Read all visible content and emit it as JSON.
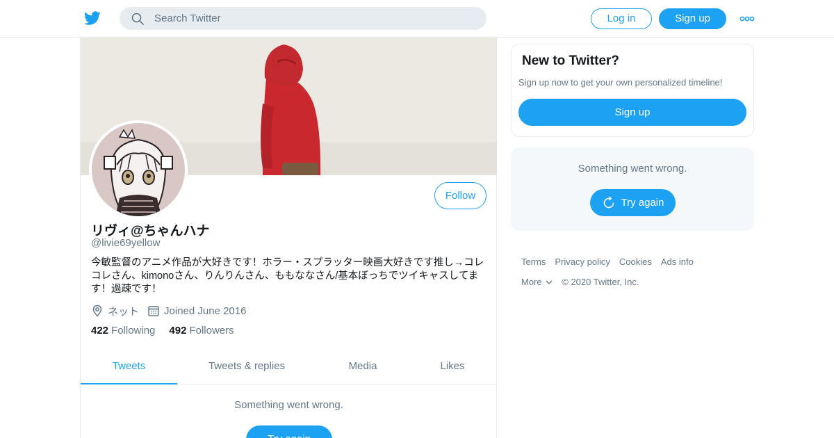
{
  "header": {
    "search_placeholder": "Search Twitter",
    "login_label": "Log in",
    "signup_label": "Sign up",
    "brand_color": "#1da1f2"
  },
  "profile": {
    "display_name": "リヴィ@ちゃんハナ",
    "handle": "@livie69yellow",
    "bio": "今敏監督のアニメ作品が大好きです！ホラー・スプラッター映画大好きです推し→コレコレさん、kimonoさん、りんりんさん、ももななさん/基本ぼっちでツイキャスしてます！過疎です！",
    "location": "ネット",
    "joined": "Joined June 2016",
    "follow_label": "Follow",
    "following_count": "422",
    "following_label": "Following",
    "followers_count": "492",
    "followers_label": "Followers"
  },
  "tabs": [
    {
      "label": "Tweets",
      "active": true
    },
    {
      "label": "Tweets & replies",
      "active": false
    },
    {
      "label": "Media",
      "active": false
    },
    {
      "label": "Likes",
      "active": false
    }
  ],
  "feed": {
    "error_message": "Something went wrong.",
    "retry_label": "Try again"
  },
  "sidebar": {
    "new_title": "New to Twitter?",
    "new_subtitle": "Sign up now to get your own personalized timeline!",
    "signup_label": "Sign up",
    "error_message": "Something went wrong.",
    "retry_label": "Try again"
  },
  "footer": {
    "links": [
      "Terms",
      "Privacy policy",
      "Cookies",
      "Ads info"
    ],
    "more_label": "More",
    "copyright": "© 2020 Twitter, Inc."
  }
}
